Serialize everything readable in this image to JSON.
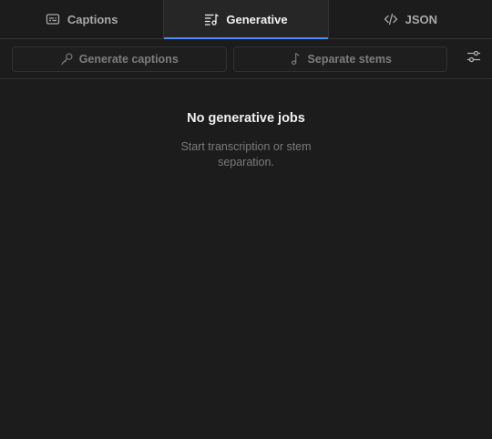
{
  "tabs": [
    {
      "label": "Captions",
      "icon": "captions-icon",
      "active": false
    },
    {
      "label": "Generative",
      "icon": "generative-icon",
      "active": true
    },
    {
      "label": "JSON",
      "icon": "code-icon",
      "active": false
    }
  ],
  "toolbar": {
    "generate_captions_label": "Generate captions",
    "separate_stems_label": "Separate stems",
    "settings_icon": "sliders-icon"
  },
  "empty_state": {
    "title": "No generative jobs",
    "description": "Start transcription or stem separation."
  },
  "colors": {
    "background": "#1c1c1c",
    "active_tab_background": "#262626",
    "accent": "#4d8df5",
    "border": "#333333"
  }
}
